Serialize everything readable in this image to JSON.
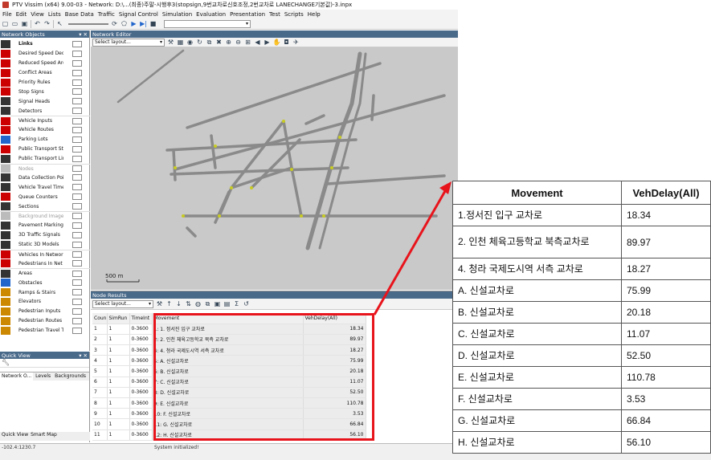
{
  "window": {
    "title": "PTV Vissim (x64) 9.00-03 - Network: D:\\...(최종)주말-시행후3(stopsign,9번교차로신호조정,2번교차로 LANECHANGE기본값)-3.inpx"
  },
  "menu": [
    "File",
    "Edit",
    "View",
    "Lists",
    "Base Data",
    "Traffic",
    "Signal Control",
    "Simulation",
    "Evaluation",
    "Presentation",
    "Test",
    "Scripts",
    "Help"
  ],
  "network_objects": {
    "header": "Network Objects",
    "items": [
      {
        "label": "Links",
        "icon": "links-icon",
        "color": "#333333",
        "bold": true
      },
      {
        "label": "Desired Speed Deci",
        "icon": "desired-speed-icon",
        "color": "#cc0000"
      },
      {
        "label": "Reduced Speed Are",
        "icon": "reduced-speed-icon",
        "color": "#cc0000"
      },
      {
        "label": "Conflict Areas",
        "icon": "conflict-areas-icon",
        "color": "#cc0000"
      },
      {
        "label": "Priority Rules",
        "icon": "priority-rules-icon",
        "color": "#cc0000"
      },
      {
        "label": "Stop Signs",
        "icon": "stop-sign-icon",
        "color": "#cc0000"
      },
      {
        "label": "Signal Heads",
        "icon": "signal-heads-icon",
        "color": "#333333"
      },
      {
        "label": "Detectors",
        "icon": "detectors-icon",
        "color": "#333333"
      },
      {
        "label": "Vehicle Inputs",
        "icon": "vehicle-inputs-icon",
        "color": "#cc0000",
        "group": true
      },
      {
        "label": "Vehicle Routes",
        "icon": "vehicle-routes-icon",
        "color": "#cc0000"
      },
      {
        "label": "Parking Lots",
        "icon": "parking-lots-icon",
        "color": "#2266cc"
      },
      {
        "label": "Public Transport St",
        "icon": "pt-stops-icon",
        "color": "#cc0000"
      },
      {
        "label": "Public Transport Lin",
        "icon": "pt-lines-icon",
        "color": "#333333"
      },
      {
        "label": "Nodes",
        "icon": "nodes-icon",
        "color": "#bbbbbb",
        "dim": true,
        "group": true
      },
      {
        "label": "Data Collection Poi",
        "icon": "data-collection-icon",
        "color": "#333333"
      },
      {
        "label": "Vehicle Travel Time",
        "icon": "travel-time-icon",
        "color": "#333333"
      },
      {
        "label": "Queue Counters",
        "icon": "queue-counters-icon",
        "color": "#cc0000"
      },
      {
        "label": "Sections",
        "icon": "sections-icon",
        "color": "#333333"
      },
      {
        "label": "Background Image",
        "icon": "background-image-icon",
        "color": "#bbbbbb",
        "dim": true,
        "group": true
      },
      {
        "label": "Pavement Markings",
        "icon": "pavement-markings-icon",
        "color": "#333333"
      },
      {
        "label": "3D Traffic Signals",
        "icon": "3d-signals-icon",
        "color": "#333333"
      },
      {
        "label": "Static 3D Models",
        "icon": "static-3d-icon",
        "color": "#333333"
      },
      {
        "label": "Vehicles In Networ",
        "icon": "vehicles-network-icon",
        "color": "#cc0000",
        "group": true
      },
      {
        "label": "Pedestrians In Net",
        "icon": "pedestrians-network-icon",
        "color": "#cc0000"
      },
      {
        "label": "Areas",
        "icon": "areas-icon",
        "color": "#333333",
        "group": true
      },
      {
        "label": "Obstacles",
        "icon": "obstacles-icon",
        "color": "#2266cc"
      },
      {
        "label": "Ramps & Stairs",
        "icon": "ramps-icon",
        "color": "#cc8800"
      },
      {
        "label": "Elevators",
        "icon": "elevators-icon",
        "color": "#cc8800"
      },
      {
        "label": "Pedestrian Inputs",
        "icon": "ped-inputs-icon",
        "color": "#cc8800"
      },
      {
        "label": "Pedestrian Routes",
        "icon": "ped-routes-icon",
        "color": "#cc8800"
      },
      {
        "label": "Pedestrian Travel Ti",
        "icon": "ped-travel-icon",
        "color": "#cc8800"
      }
    ],
    "tabs": [
      "Network O...",
      "Levels",
      "Backgrounds"
    ]
  },
  "quick_view": {
    "header": "Quick View",
    "tabs": [
      "Quick View",
      "Smart Map"
    ]
  },
  "editor": {
    "header": "Network Editor",
    "layout_placeholder": "Select layout...",
    "scale_label": "500 m"
  },
  "node_results": {
    "header": "Node Results",
    "layout_placeholder": "Select layout...",
    "columns": [
      "Coun",
      "SimRun",
      "TimeInt",
      "Movement",
      "VehDelay(All)"
    ],
    "rows": [
      [
        "1",
        "1",
        "0-3600",
        "1: 1. 정서진 입구 교차로",
        "18.34"
      ],
      [
        "2",
        "1",
        "0-3600",
        "2: 2. 인천 체육고등학교 북측 교차로",
        "89.97"
      ],
      [
        "3",
        "1",
        "0-3600",
        "4: 4. 청라 국제도시역 서측 교차로",
        "18.27"
      ],
      [
        "4",
        "1",
        "0-3600",
        "5: A. 신설교차로",
        "75.99"
      ],
      [
        "5",
        "1",
        "0-3600",
        "6: B. 신설교차로",
        "20.18"
      ],
      [
        "6",
        "1",
        "0-3600",
        "7: C. 신설교차로",
        "11.07"
      ],
      [
        "7",
        "1",
        "0-3600",
        "8: D. 신설교차로",
        "52.50"
      ],
      [
        "8",
        "1",
        "0-3600",
        "9: E. 신설교차로",
        "110.78"
      ],
      [
        "9",
        "1",
        "0-3600",
        "10: F. 신설교차로",
        "3.53"
      ],
      [
        "10",
        "1",
        "0-3600",
        "11: G. 신설교차로",
        "66.84"
      ],
      [
        "11",
        "1",
        "0-3600",
        "12: H. 신설교차로",
        "56.10"
      ]
    ]
  },
  "callout": {
    "headers": [
      "Movement",
      "VehDelay(All)"
    ],
    "rows": [
      [
        "1.정서진 입구 교차로",
        "18.34"
      ],
      [
        "2. 인천 체육고등학교 북측교차로",
        "89.97"
      ],
      [
        "4. 청라 국제도시역 서측 교차로",
        "18.27"
      ],
      [
        "A. 신설교차로",
        "75.99"
      ],
      [
        "B. 신설교차로",
        "20.18"
      ],
      [
        "C. 신설교차로",
        "11.07"
      ],
      [
        "D. 신설교차로",
        "52.50"
      ],
      [
        "E. 신설교차로",
        "110.78"
      ],
      [
        "F. 신설교차로",
        "3.53"
      ],
      [
        "G. 신설교차로",
        "66.84"
      ],
      [
        "H. 신설교차로",
        "56.10"
      ]
    ],
    "accent_color": "#e8141c"
  },
  "status": {
    "coords": "-102.4:1230.7",
    "message": "System initialized!"
  }
}
